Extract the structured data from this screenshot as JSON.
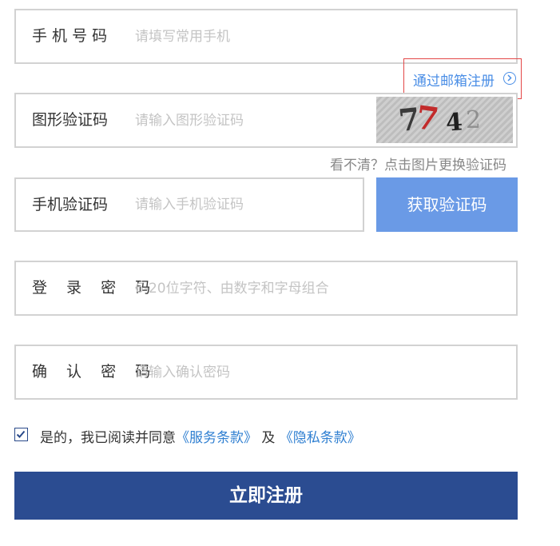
{
  "form": {
    "phone": {
      "label": "手 机 号 码",
      "placeholder": "请填写常用手机"
    },
    "email_register_link": "通过邮箱注册",
    "captcha": {
      "label": "图形验证码",
      "placeholder": "请输入图形验证码",
      "image_text": [
        "7",
        "7",
        "4",
        "2"
      ],
      "hint": "看不清？点击图片更换验证码"
    },
    "sms_code": {
      "label": "手机验证码",
      "placeholder": "请输入手机验证码",
      "button": "获取验证码"
    },
    "password": {
      "label": "登 录 密 码",
      "placeholder": "6-20位字符、由数字和字母组合"
    },
    "confirm_password": {
      "label": "确 认 密 码",
      "placeholder": "请输入确认密码"
    },
    "agreement": {
      "checked": true,
      "prefix": "是的，我已阅读并同意",
      "terms": "《服务条款》",
      "and": " 及 ",
      "privacy": "《隐私条款》"
    },
    "submit": "立即注册"
  },
  "colors": {
    "primary": "#2b4c91",
    "button_light": "#6a9ae6",
    "link": "#4a8ee6",
    "highlight_border": "#e34747"
  }
}
